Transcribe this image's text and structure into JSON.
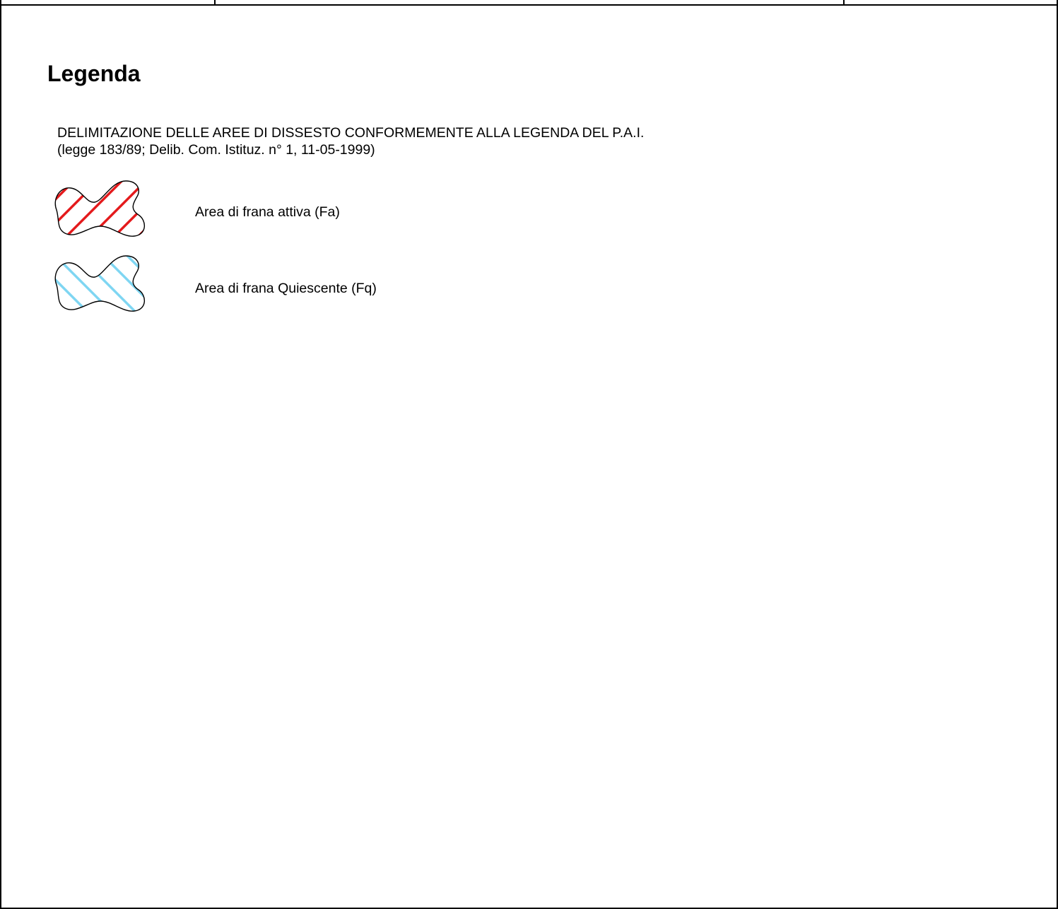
{
  "legend": {
    "title": "Legenda",
    "subtitle_line1": "DELIMITAZIONE DELLE AREE DI DISSESTO CONFORMEMENTE ALLA LEGENDA DEL P.A.I.",
    "subtitle_line2": "(legge 183/89; Delib. Com. Istituz. n° 1, 11-05-1999)",
    "items": [
      {
        "label": "Area di frana attiva (Fa)",
        "hatch_color": "#e41a1c",
        "hatch_direction": "forward-diagonal",
        "symbol_icon": "red-hatched-landslide-area-icon"
      },
      {
        "label": "Area di frana Quiescente (Fq)",
        "hatch_color": "#7fd6f2",
        "hatch_direction": "backward-diagonal",
        "symbol_icon": "blue-hatched-landslide-area-icon"
      }
    ]
  }
}
